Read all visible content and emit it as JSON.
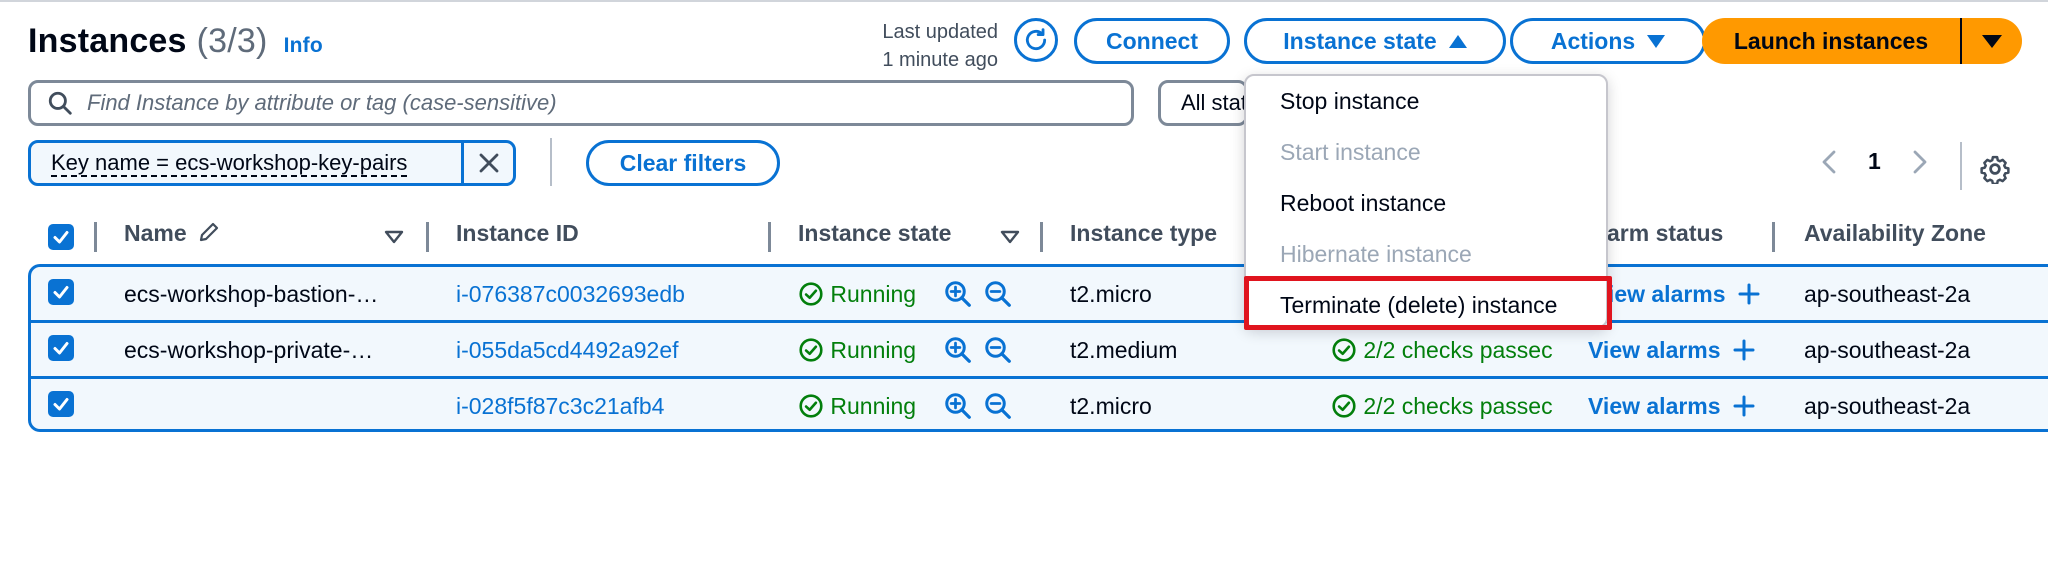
{
  "header": {
    "title": "Instances",
    "count": "(3/3)",
    "info_label": "Info",
    "last_updated_line1": "Last updated",
    "last_updated_line2": "1 minute ago",
    "connect_label": "Connect",
    "instance_state_label": "Instance state",
    "actions_label": "Actions",
    "launch_label": "Launch instances"
  },
  "filters": {
    "search_placeholder": "Find Instance by attribute or tag (case-sensitive)",
    "state_select_value": "All states",
    "token_label": "Key name = ecs-workshop-key-pairs",
    "clear_filters_label": "Clear filters"
  },
  "pagination": {
    "current_page": "1"
  },
  "table": {
    "columns": [
      "Name",
      "Instance ID",
      "Instance state",
      "Instance type",
      "Alarm status",
      "Availability Zone"
    ],
    "rows": [
      {
        "name": "ecs-workshop-bastion-…",
        "instance_id": "i-076387c0032693edb",
        "state": "Running",
        "type": "t2.micro",
        "status_check": "",
        "alarm_link": "View alarms",
        "zone": "ap-southeast-2a"
      },
      {
        "name": "ecs-workshop-private-…",
        "instance_id": "i-055da5cd4492a92ef",
        "state": "Running",
        "type": "t2.medium",
        "status_check": "2/2 checks passec",
        "alarm_link": "View alarms",
        "zone": "ap-southeast-2a"
      },
      {
        "name": "",
        "instance_id": "i-028f5f87c3c21afb4",
        "state": "Running",
        "type": "t2.micro",
        "status_check": "2/2 checks passec",
        "alarm_link": "View alarms",
        "zone": "ap-southeast-2a"
      }
    ]
  },
  "menu": {
    "items": [
      {
        "label": "Stop instance",
        "enabled": true
      },
      {
        "label": "Start instance",
        "enabled": false
      },
      {
        "label": "Reboot instance",
        "enabled": true
      },
      {
        "label": "Hibernate instance",
        "enabled": false
      },
      {
        "label": "Terminate (delete) instance",
        "enabled": true
      }
    ],
    "highlighted_index": 4
  },
  "colors": {
    "primary": "#0972d3",
    "success": "#037f0c",
    "launch": "#ff9900",
    "highlight": "#e0141e"
  },
  "icons": {
    "search": "search-icon",
    "refresh": "refresh-icon",
    "close": "close-icon",
    "edit": "pencil-icon",
    "sort": "sort-caret-icon",
    "running": "check-circle-icon",
    "zoom_in": "zoom-in-icon",
    "zoom_out": "zoom-out-icon",
    "add": "plus-icon",
    "settings": "gear-icon",
    "prev": "chevron-left-icon",
    "next": "chevron-right-icon"
  }
}
